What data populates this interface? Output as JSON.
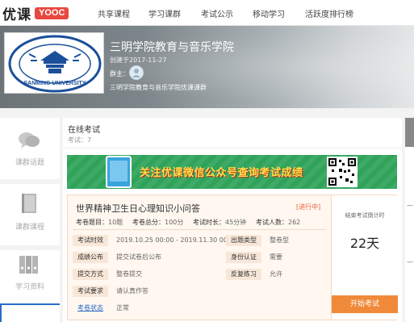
{
  "header": {
    "logo_text": "优课",
    "logo_badge": "YOOC",
    "nav": [
      "共享课程",
      "学习课群",
      "考试公示",
      "移动学习",
      "活跃度排行榜"
    ]
  },
  "banner": {
    "title": "三明学院教育与音乐学院",
    "created": "创建于2017-11-27",
    "owner_label": "群主：",
    "group_name": "三明学院教育与音乐学院优课课群",
    "school_logo_text": "SANMING UNIVERSITY"
  },
  "sidebar": {
    "items": [
      {
        "label": "课群话题",
        "icon": "chat-bubbles-icon"
      },
      {
        "label": "课群课程",
        "icon": "book-icon"
      },
      {
        "label": "学习资料",
        "icon": "binders-icon"
      }
    ]
  },
  "main": {
    "heading": "在线考试",
    "count": "考试：7",
    "ad_text": "关注优课微信公众号查询考试成绩",
    "exam": {
      "title": "世界精神卫生日心理知识小问答",
      "status": "[进行中]",
      "meta": [
        {
          "k": "考卷题目：",
          "v": "10题"
        },
        {
          "k": "考卷总分：",
          "v": "100分"
        },
        {
          "k": "考试时长：",
          "v": "45分钟"
        },
        {
          "k": "考试人数：",
          "v": "262"
        }
      ],
      "rows": [
        {
          "label": "考试时效",
          "value": "2019.10.25 00:00 - 2019.11.30 00:00"
        },
        {
          "label": "出题类型",
          "value": "整卷型"
        },
        {
          "label": "成绩公布",
          "value": "提交试卷后公布"
        },
        {
          "label": "身份认证",
          "value": "需要"
        },
        {
          "label": "提交方式",
          "value": "整卷提交"
        },
        {
          "label": "反复练习",
          "value": "允许"
        },
        {
          "label": "考试要求",
          "value": "请认真作答"
        },
        {
          "label": "考卷状态",
          "value": "正常"
        }
      ],
      "countdown_label": "结束考试倒计时",
      "countdown_value": "22天",
      "start_button": "开始考试"
    }
  },
  "colors": {
    "accent": "#e8483f",
    "button": "#f08a3a",
    "status": "#e8633a",
    "link": "#2b6cc8",
    "ad_green": "#2fa35a"
  }
}
